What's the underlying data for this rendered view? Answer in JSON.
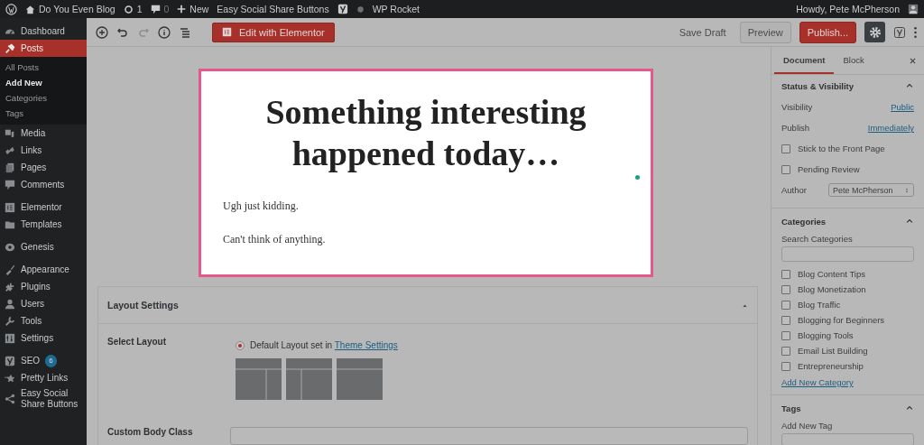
{
  "admin_bar": {
    "site": "Do You Even Blog",
    "updates": "1",
    "comments": "0",
    "new": "New",
    "links": [
      "Easy Social Share Buttons",
      "WP Rocket"
    ],
    "greeting": "Howdy, Pete McPherson"
  },
  "menu": [
    {
      "label": "Dashboard",
      "selected": false
    },
    {
      "label": "Posts",
      "selected": true,
      "children": [
        {
          "label": "All Posts",
          "selected": false
        },
        {
          "label": "Add New",
          "selected": true
        },
        {
          "label": "Categories",
          "selected": false
        },
        {
          "label": "Tags",
          "selected": false
        }
      ]
    },
    {
      "label": "Media",
      "selected": false
    },
    {
      "label": "Links",
      "selected": false
    },
    {
      "label": "Pages",
      "selected": false
    },
    {
      "label": "Comments",
      "selected": false
    },
    {
      "label": "Elementor",
      "selected": false
    },
    {
      "label": "Templates",
      "selected": false
    },
    {
      "label": "Genesis",
      "selected": false
    },
    {
      "label": "Appearance",
      "selected": false
    },
    {
      "label": "Plugins",
      "selected": false
    },
    {
      "label": "Users",
      "selected": false
    },
    {
      "label": "Tools",
      "selected": false
    },
    {
      "label": "Settings",
      "selected": false
    },
    {
      "label": "SEO",
      "selected": false,
      "badge": "6"
    },
    {
      "label": "Pretty Links",
      "selected": false
    },
    {
      "label": "Easy Social Share Buttons",
      "selected": false
    }
  ],
  "toolbar": {
    "elementor_button": "Edit with Elementor",
    "save_draft": "Save Draft",
    "preview": "Preview",
    "publish": "Publish...",
    "settings_on": true,
    "redo_disabled": true
  },
  "post": {
    "title": "Something interesting happened today…",
    "paragraphs": [
      "Ugh just kidding.",
      "Can't think of anything."
    ]
  },
  "layout_settings": {
    "title": "Layout Settings",
    "select_label": "Select Layout",
    "option_text": "Default Layout set in ",
    "option_link": "Theme Settings",
    "option_selected": true,
    "body_class_label": "Custom Body Class"
  },
  "sidebar": {
    "tabs": [
      {
        "label": "Document",
        "selected": true
      },
      {
        "label": "Block",
        "selected": false
      }
    ],
    "status": {
      "title": "Status & Visibility",
      "expanded": true,
      "visibility_label": "Visibility",
      "visibility": "Public",
      "publish_label": "Publish",
      "publish": "Immediately",
      "options": [
        {
          "label": "Stick to the Front Page",
          "checked": false
        },
        {
          "label": "Pending Review",
          "checked": false
        }
      ],
      "author_label": "Author",
      "author": "Pete McPherson"
    },
    "categories": {
      "title": "Categories",
      "expanded": true,
      "search_label": "Search Categories",
      "items": [
        {
          "label": "Blog Content Tips",
          "checked": false
        },
        {
          "label": "Blog Monetization",
          "checked": false
        },
        {
          "label": "Blog Traffic",
          "checked": false
        },
        {
          "label": "Blogging for Beginners",
          "checked": false
        },
        {
          "label": "Blogging Tools",
          "checked": false
        },
        {
          "label": "Email List Building",
          "checked": false
        },
        {
          "label": "Entrepreneurship",
          "checked": false
        }
      ],
      "add_link": "Add New Category"
    },
    "tags": {
      "title": "Tags",
      "expanded": true,
      "add_label": "Add New Tag"
    }
  }
}
